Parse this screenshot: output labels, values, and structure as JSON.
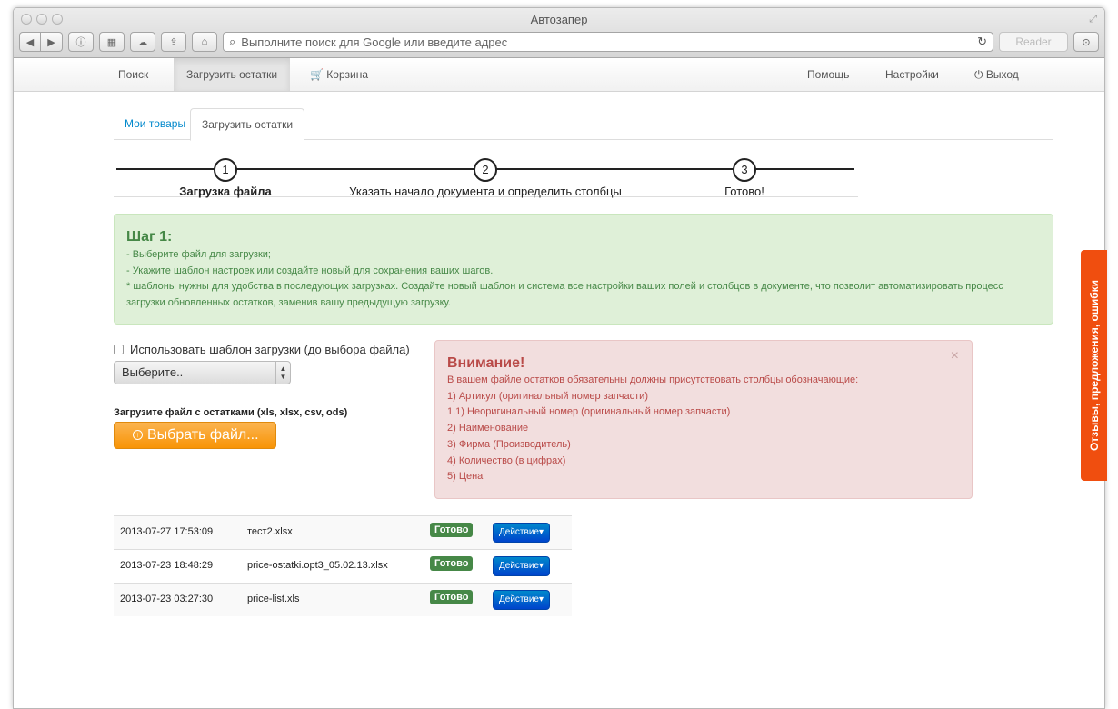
{
  "browser": {
    "window_title": "Автозапер",
    "address_placeholder": "Выполните поиск для Google или введите адрес",
    "reader_label": "Reader"
  },
  "navbar": {
    "search": "Поиск",
    "upload": "Загрузить остатки",
    "cart": "Корзина",
    "help": "Помощь",
    "settings": "Настройки",
    "logout": "Выход"
  },
  "tabs": {
    "my_goods": "Мои товары",
    "upload": "Загрузить остатки"
  },
  "wizard": {
    "steps": [
      {
        "num": "1",
        "label": "Загрузка файла"
      },
      {
        "num": "2",
        "label": "Указать начало документа и определить столбцы"
      },
      {
        "num": "3",
        "label": "Готово!"
      }
    ]
  },
  "info": {
    "title": "Шаг 1:",
    "lines": [
      "- Выберите файл для загрузки;",
      "- Укажите шаблон настроек или создайте новый для сохранения ваших шагов.",
      "* шаблоны нужны для удобства в последующих загрузках. Создайте новый шаблон и система все настройки ваших полей и столбцов в документе, что позволит автоматизировать процесс загрузки обновленных остатков, заменив вашу предыдущую загрузку."
    ]
  },
  "form": {
    "template_checkbox": "Использовать шаблон загрузки (до выбора файла)",
    "select_value": "Выберите..",
    "upload_label": "Загрузите файл с остатками (xls, xlsx, csv, ods)",
    "file_button": "Выбрать файл..."
  },
  "warning": {
    "title": "Внимание!",
    "intro": "В вашем файле остатков обязательны должны присутствовать столбцы обозначающие:",
    "items": [
      "1) Артикул (оригинальный номер запчасти)",
      "1.1) Неоригинальный номер (оригинальный номер запчасти)",
      "2) Наименование",
      "3) Фирма (Производитель)",
      "4) Количество (в цифрах)",
      "5) Цена"
    ],
    "close": "×"
  },
  "uploads": [
    {
      "date": "2013-07-27 17:53:09",
      "file": "тест2.xlsx",
      "status": "Готово",
      "action": "Действие"
    },
    {
      "date": "2013-07-23 18:48:29",
      "file": "price-ostatki.opt3_05.02.13.xlsx",
      "status": "Готово",
      "action": "Действие"
    },
    {
      "date": "2013-07-23 03:27:30",
      "file": "price-list.xls",
      "status": "Готово",
      "action": "Действие"
    }
  ],
  "feedback": "Отзывы, предложения, ошибки",
  "colors": {
    "success": "#468847",
    "danger": "#b94a48",
    "warning_btn": "#f89406",
    "primary": "#0044cc",
    "feedback": "#f04e0f"
  }
}
